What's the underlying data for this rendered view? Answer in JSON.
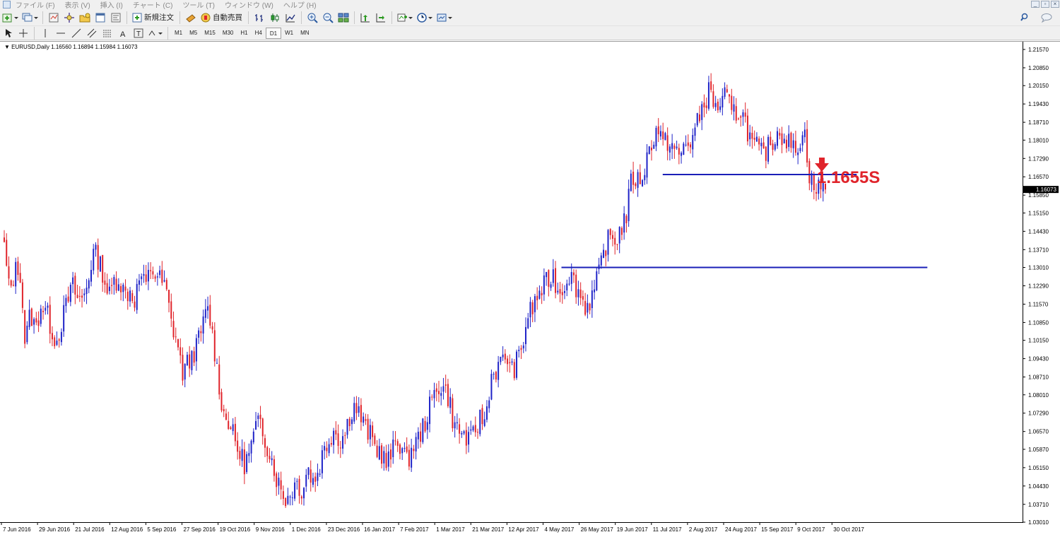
{
  "menu": {
    "items": [
      "ファイル (F)",
      "表示 (V)",
      "挿入 (I)",
      "チャート (C)",
      "ツール (T)",
      "ウィンドウ (W)",
      "ヘルプ (H)"
    ]
  },
  "toolbar": {
    "new_order_label": "新規注文",
    "auto_trading_label": "自動売買",
    "timeframes": [
      "M1",
      "M5",
      "M15",
      "M30",
      "H1",
      "H4",
      "D1",
      "W1",
      "MN"
    ],
    "active_timeframe": "D1"
  },
  "chart_header": {
    "symbol": "EURUSD,Daily",
    "ohlc": "1.16560 1.16894 1.15984 1.16073"
  },
  "annotation": {
    "text": "1.1655S",
    "color": "#e0242b"
  },
  "colors": {
    "bull_candle": "#1f23c8",
    "bear_candle": "#e0242b",
    "level_line": "#1a1fb8"
  },
  "chart_data": {
    "type": "candlestick",
    "symbol": "EURUSD",
    "timeframe": "Daily",
    "ylim": [
      1.0301,
      1.2157
    ],
    "y_ticks": [
      "1.21570",
      "1.20850",
      "1.20150",
      "1.19430",
      "1.18710",
      "1.18010",
      "1.17290",
      "1.16570",
      "1.15850",
      "1.15150",
      "1.14430",
      "1.13710",
      "1.13010",
      "1.12290",
      "1.11570",
      "1.10850",
      "1.10150",
      "1.09430",
      "1.08710",
      "1.08010",
      "1.07290",
      "1.06570",
      "1.05870",
      "1.05150",
      "1.04430",
      "1.03710",
      "1.03010"
    ],
    "x_ticks": [
      "7 Jun 2016",
      "29 Jun 2016",
      "21 Jul 2016",
      "12 Aug 2016",
      "5 Sep 2016",
      "27 Sep 2016",
      "19 Oct 2016",
      "9 Nov 2016",
      "1 Dec 2016",
      "23 Dec 2016",
      "16 Jan 2017",
      "7 Feb 2017",
      "1 Mar 2017",
      "21 Mar 2017",
      "12 Apr 2017",
      "4 May 2017",
      "26 May 2017",
      "19 Jun 2017",
      "11 Jul 2017",
      "2 Aug 2017",
      "24 Aug 2017",
      "15 Sep 2017",
      "9 Oct 2017",
      "30 Oct 2017"
    ],
    "current_price": "1.16073",
    "horizontal_levels": [
      {
        "price": 1.1666,
        "from": "11 Jul 2017",
        "to": "30 Oct 2017"
      },
      {
        "price": 1.1301,
        "from": "4 May 2017",
        "to": "30 Oct 2017"
      }
    ],
    "path_close": [
      1.138,
      1.12,
      1.1285,
      1.13,
      1.1,
      1.1125,
      1.1055,
      1.1155,
      1.113,
      1.106,
      1.101,
      1.109,
      1.116,
      1.123,
      1.118,
      1.1175,
      1.125,
      1.136,
      1.1335,
      1.127,
      1.118,
      1.125,
      1.126,
      1.1195,
      1.121,
      1.1175,
      1.1275,
      1.122,
      1.13,
      1.127,
      1.125,
      1.1205,
      1.1075,
      1.102,
      1.0885,
      1.092,
      1.096,
      1.1,
      1.108,
      1.114,
      1.101,
      1.085,
      1.072,
      1.07,
      1.062,
      1.057,
      1.053,
      1.058,
      1.0665,
      1.069,
      1.062,
      1.056,
      1.048,
      1.042,
      1.039,
      1.043,
      1.046,
      1.042,
      1.052,
      1.046,
      1.05,
      1.058,
      1.062,
      1.067,
      1.0625,
      1.064,
      1.072,
      1.076,
      1.072,
      1.067,
      1.064,
      1.059,
      1.058,
      1.053,
      1.056,
      1.063,
      1.06,
      1.053,
      1.06,
      1.062,
      1.067,
      1.073,
      1.079,
      1.084,
      1.083,
      1.079,
      1.068,
      1.066,
      1.064,
      1.061,
      1.066,
      1.071,
      1.07,
      1.087,
      1.09,
      1.092,
      1.096,
      1.089,
      1.093,
      1.098,
      1.111,
      1.114,
      1.119,
      1.122,
      1.125,
      1.127,
      1.12,
      1.123,
      1.128,
      1.124,
      1.12,
      1.115,
      1.117,
      1.122,
      1.13,
      1.139,
      1.142,
      1.141,
      1.146,
      1.151,
      1.166,
      1.164,
      1.166,
      1.174,
      1.181,
      1.185,
      1.178,
      1.18,
      1.177,
      1.173,
      1.178,
      1.179,
      1.183,
      1.19,
      1.196,
      1.2,
      1.192,
      1.195,
      1.198,
      1.19,
      1.191,
      1.192,
      1.185,
      1.178,
      1.177,
      1.174,
      1.177,
      1.18,
      1.184,
      1.182,
      1.179,
      1.176,
      1.18,
      1.183,
      1.166,
      1.16,
      1.162,
      1.1607
    ]
  }
}
